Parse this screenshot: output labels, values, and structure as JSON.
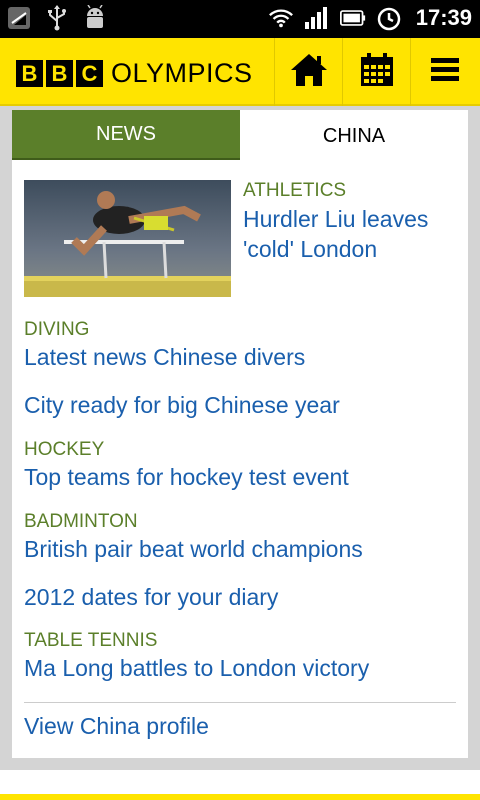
{
  "status_bar": {
    "time": "17:39",
    "icons": [
      "signal-app-icon",
      "usb-icon",
      "android-debug-icon",
      "wifi-icon",
      "cell-signal-icon",
      "battery-icon",
      "alarm-icon"
    ]
  },
  "header": {
    "logo_letters": [
      "B",
      "B",
      "C"
    ],
    "logo_text": "OLYMPICS",
    "buttons": [
      "home-icon",
      "calendar-icon",
      "menu-icon"
    ],
    "colors": {
      "brand_yellow": "#ffe400",
      "tab_green": "#5b7f2a",
      "link_blue": "#1a5fad"
    }
  },
  "tabs": {
    "news": "NEWS",
    "china": "CHINA"
  },
  "articles": [
    {
      "category": "ATHLETICS",
      "title_line1": "Hurdler Liu leaves",
      "title_line2": "'cold' London"
    },
    {
      "category": "DIVING",
      "title": "Latest news Chinese divers"
    },
    {
      "category": "",
      "title": "City ready for big Chinese year"
    },
    {
      "category": "HOCKEY",
      "title": "Top teams for hockey test event"
    },
    {
      "category": "BADMINTON",
      "title": "British pair beat world champions"
    },
    {
      "category": "",
      "title": "2012 dates for your diary"
    },
    {
      "category": "TABLE TENNIS",
      "title": "Ma Long battles to London victory"
    }
  ],
  "profile_link": "View China profile"
}
